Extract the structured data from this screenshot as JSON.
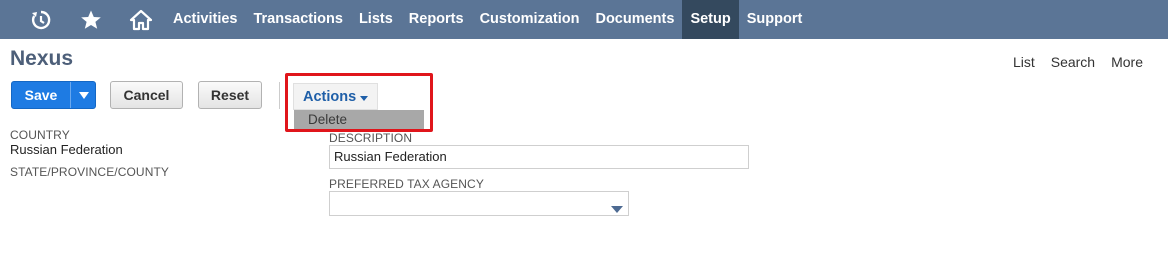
{
  "nav": {
    "icons": [
      "recent-icon",
      "star-icon",
      "home-icon"
    ],
    "items": [
      "Activities",
      "Transactions",
      "Lists",
      "Reports",
      "Customization",
      "Documents",
      "Setup",
      "Support"
    ],
    "active": "Setup",
    "bg_color": "#5b7596",
    "active_color": "#34495e"
  },
  "page": {
    "title": "Nexus",
    "links": [
      "List",
      "Search",
      "More"
    ]
  },
  "toolbar": {
    "save_label": "Save",
    "cancel_label": "Cancel",
    "reset_label": "Reset",
    "actions_label": "Actions",
    "save_color": "#1e7be3"
  },
  "actions_menu": {
    "items": [
      "Delete"
    ]
  },
  "fields": {
    "country_label": "COUNTRY",
    "country_value": "Russian Federation",
    "state_label": "STATE/PROVINCE/COUNTY",
    "description_label": "DESCRIPTION",
    "description_value": "Russian Federation",
    "tax_agency_label": "PREFERRED TAX AGENCY",
    "tax_agency_value": ""
  },
  "highlight_color": "#e0151b"
}
